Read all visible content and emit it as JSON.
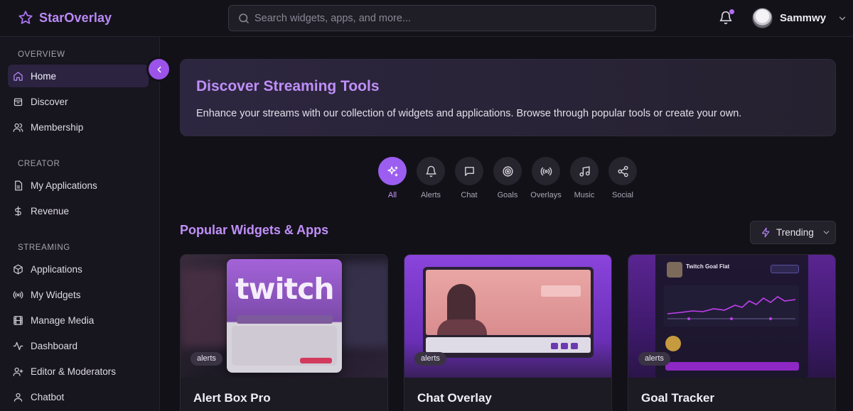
{
  "app": {
    "name": "StarOverlay"
  },
  "search": {
    "placeholder": "Search widgets, apps, and more..."
  },
  "user": {
    "name": "Sammwy",
    "has_notification": true
  },
  "sidebar": {
    "sections": [
      {
        "title": "OVERVIEW",
        "items": [
          {
            "label": "Home",
            "icon": "home-icon",
            "active": true
          },
          {
            "label": "Discover",
            "icon": "discover-icon"
          },
          {
            "label": "Membership",
            "icon": "users-icon"
          }
        ]
      },
      {
        "title": "CREATOR",
        "items": [
          {
            "label": "My Applications",
            "icon": "file-icon"
          },
          {
            "label": "Revenue",
            "icon": "dollar-icon"
          }
        ]
      },
      {
        "title": "STREAMING",
        "items": [
          {
            "label": "Applications",
            "icon": "package-icon"
          },
          {
            "label": "My Widgets",
            "icon": "radio-icon"
          },
          {
            "label": "Manage Media",
            "icon": "film-icon"
          },
          {
            "label": "Dashboard",
            "icon": "activity-icon"
          },
          {
            "label": "Editor & Moderators",
            "icon": "user-plus-icon"
          },
          {
            "label": "Chatbot",
            "icon": "bot-icon"
          }
        ]
      }
    ]
  },
  "hero": {
    "title": "Discover Streaming Tools",
    "description": "Enhance your streams with our collection of widgets and applications. Browse through popular tools or create your own."
  },
  "categories": [
    {
      "label": "All",
      "icon": "sparkles-icon",
      "active": true
    },
    {
      "label": "Alerts",
      "icon": "bell-icon"
    },
    {
      "label": "Chat",
      "icon": "message-icon"
    },
    {
      "label": "Goals",
      "icon": "target-icon"
    },
    {
      "label": "Overlays",
      "icon": "broadcast-icon"
    },
    {
      "label": "Music",
      "icon": "music-icon"
    },
    {
      "label": "Social",
      "icon": "share-icon"
    }
  ],
  "popular": {
    "title": "Popular Widgets & Apps",
    "sort_label": "Trending",
    "cards": [
      {
        "title": "Alert Box Pro",
        "tag": "alerts",
        "thumb_wordmark": "twitch"
      },
      {
        "title": "Chat Overlay",
        "tag": "alerts"
      },
      {
        "title": "Goal Tracker",
        "tag": "alerts",
        "thumb_title": "Twitch Goal Flat"
      }
    ]
  },
  "colors": {
    "accent": "#9c5ef0",
    "brand": "#b98af7",
    "background": "#121118"
  }
}
